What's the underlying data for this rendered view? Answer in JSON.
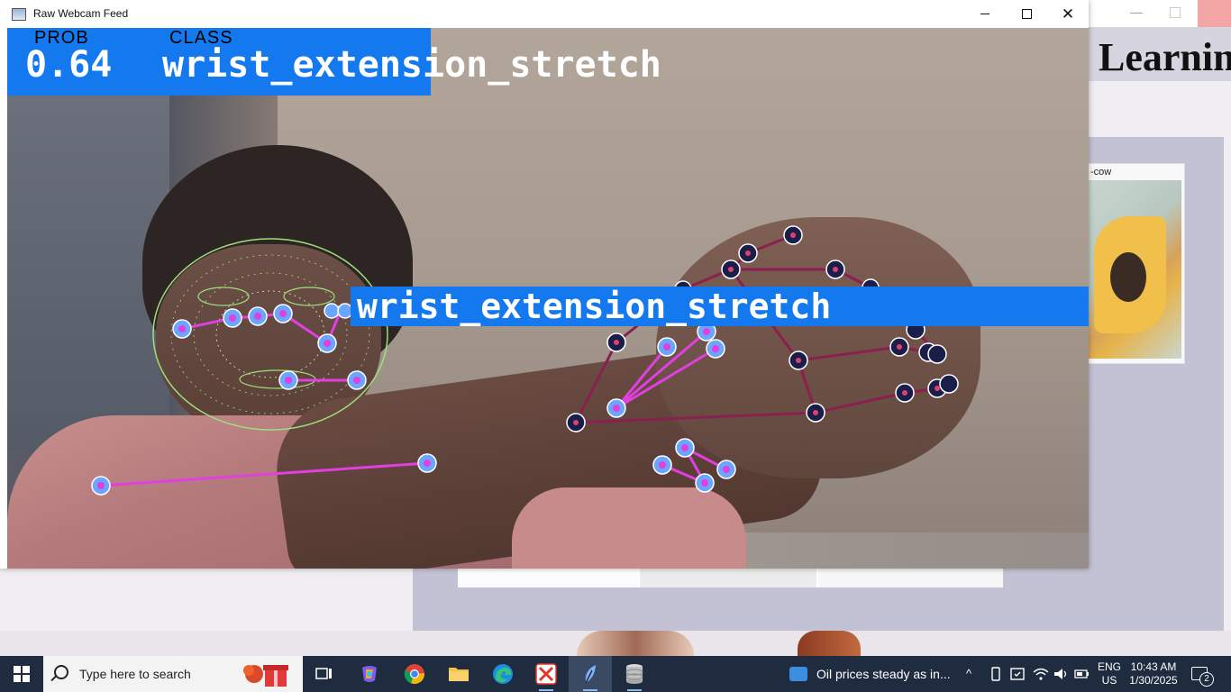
{
  "background_app": {
    "heading": "Learnin",
    "card_label": "-cow"
  },
  "window": {
    "title": "Raw Webcam Feed",
    "minimize_symbol": "—",
    "close_symbol": "✕"
  },
  "overlay": {
    "prob_header": "PROB",
    "class_header": "CLASS",
    "probability": "0.64",
    "class_name": "wrist_extension_stretch",
    "body_label": "wrist_extension_stretch"
  },
  "taskbar": {
    "search_placeholder": "Type here to search",
    "apps": [
      "task-view",
      "copilot",
      "chrome",
      "file-explorer",
      "edge",
      "xampp",
      "feather-app",
      "database-app"
    ],
    "news": "Oil prices steady as in...",
    "tray_chevron": "^",
    "language_line1": "ENG",
    "language_line2": "US",
    "time": "10:43 AM",
    "date": "1/30/2025",
    "notification_count": "2"
  },
  "colors": {
    "label_blue": "#1479ee",
    "skeleton_magenta": "#e040e0",
    "hand_edge": "#8a2050",
    "face_mesh": "#9fe07a",
    "taskbar": "#1f2b3f"
  }
}
